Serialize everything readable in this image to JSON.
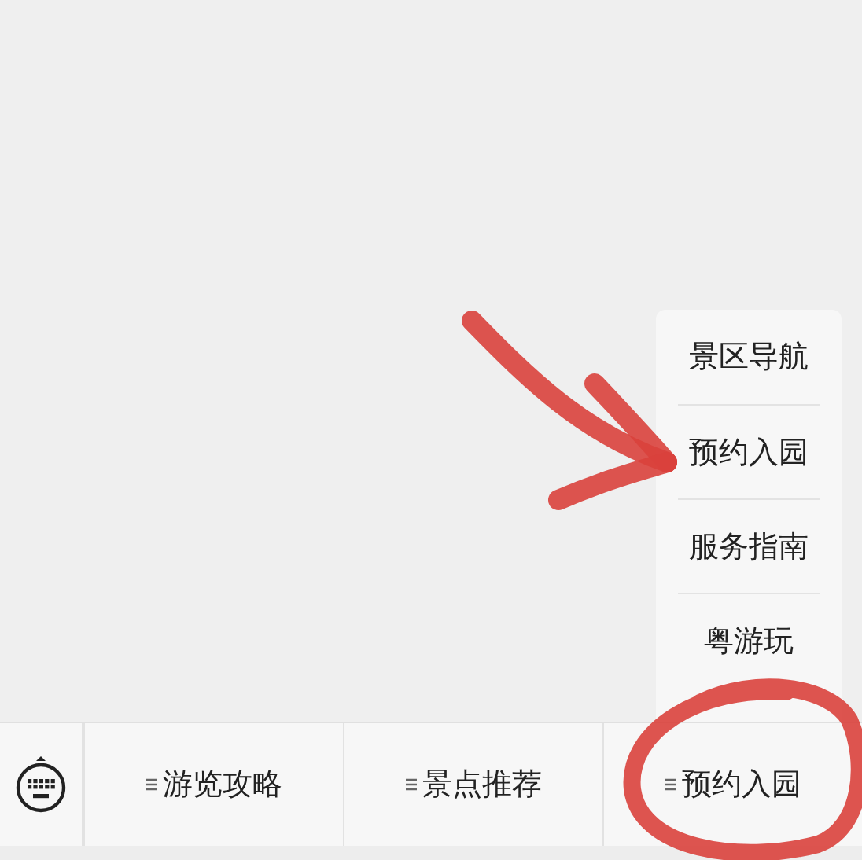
{
  "popup_menu": {
    "items": [
      {
        "label": "景区导航"
      },
      {
        "label": "预约入园"
      },
      {
        "label": "服务指南"
      },
      {
        "label": "粤游玩"
      }
    ]
  },
  "bottom_menu": {
    "items": [
      {
        "label": "游览攻略"
      },
      {
        "label": "景点推荐"
      },
      {
        "label": "预约入园"
      }
    ]
  }
}
